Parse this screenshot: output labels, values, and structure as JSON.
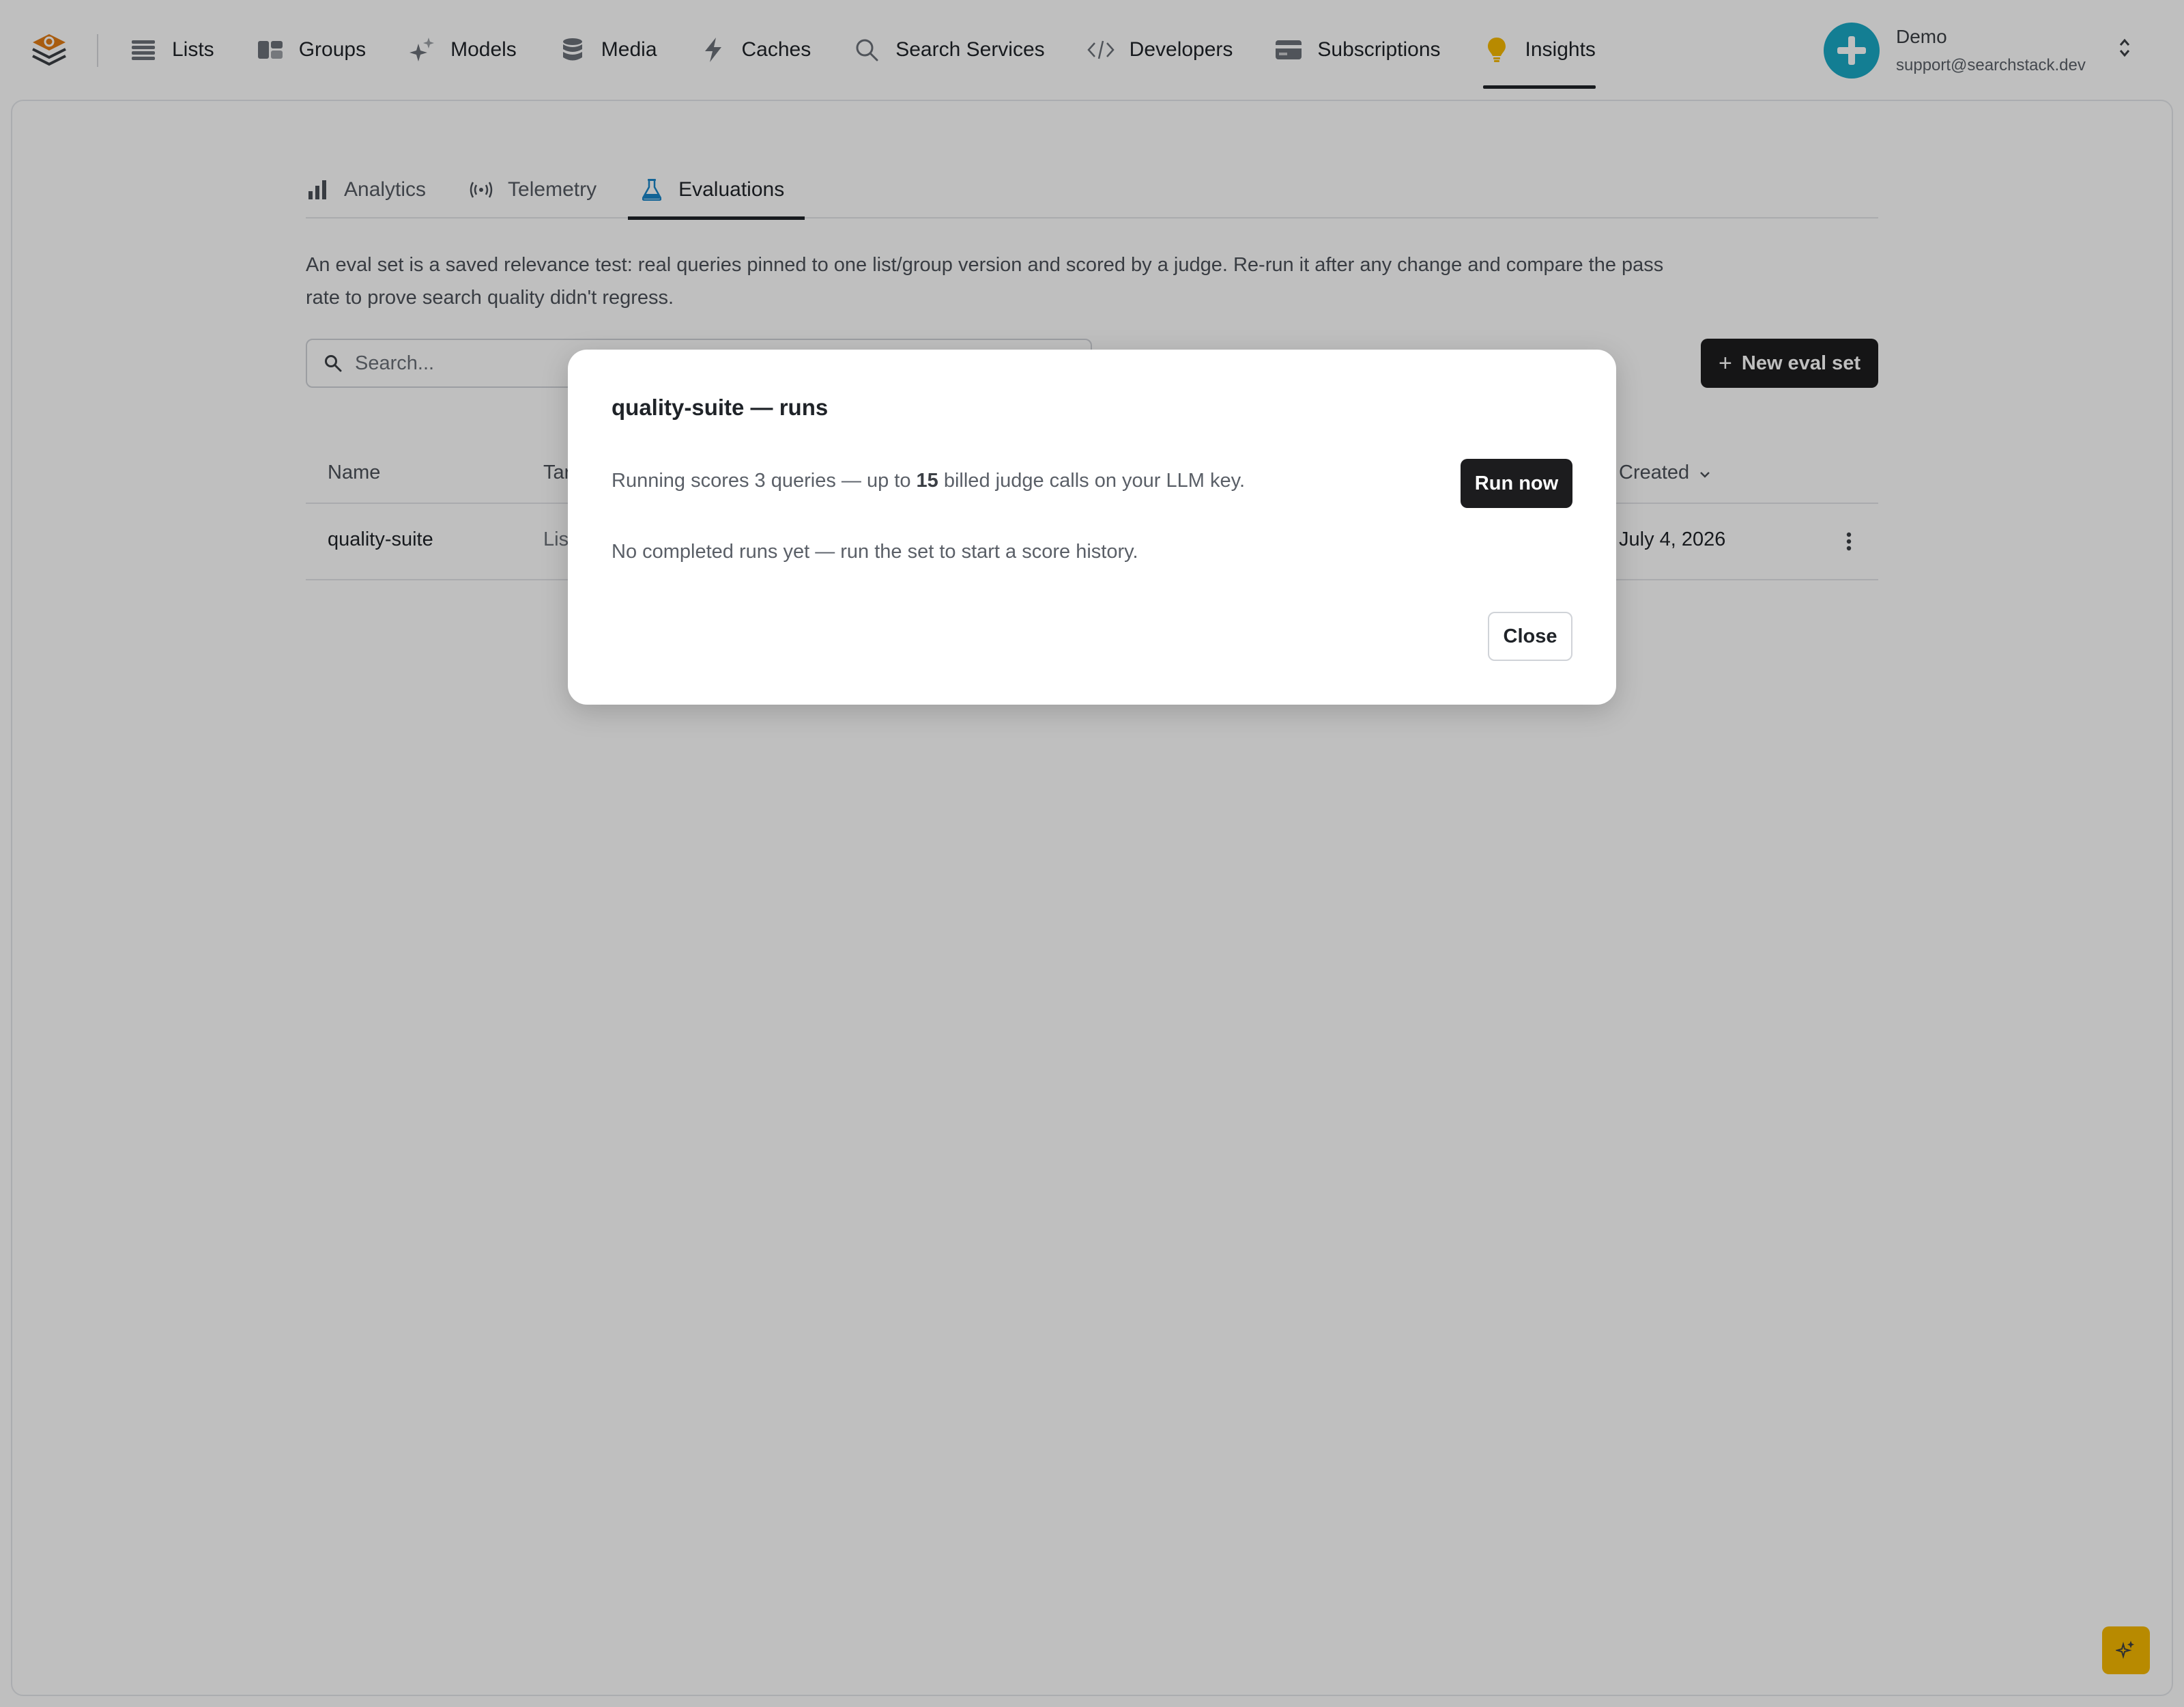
{
  "nav": {
    "items": [
      {
        "label": "Lists",
        "icon": "list-icon"
      },
      {
        "label": "Groups",
        "icon": "groups-icon"
      },
      {
        "label": "Models",
        "icon": "sparkles-icon"
      },
      {
        "label": "Media",
        "icon": "database-icon"
      },
      {
        "label": "Caches",
        "icon": "bolt-icon"
      },
      {
        "label": "Search Services",
        "icon": "search-icon"
      },
      {
        "label": "Developers",
        "icon": "code-icon"
      },
      {
        "label": "Subscriptions",
        "icon": "card-icon"
      },
      {
        "label": "Insights",
        "icon": "lightbulb-icon",
        "active": true
      }
    ]
  },
  "user": {
    "name": "Demo",
    "email": "support@searchstack.dev"
  },
  "tabs": [
    {
      "label": "Analytics",
      "icon": "bar-chart-icon"
    },
    {
      "label": "Telemetry",
      "icon": "broadcast-icon"
    },
    {
      "label": "Evaluations",
      "icon": "flask-icon",
      "active": true
    }
  ],
  "description": "An eval set is a saved relevance test: real queries pinned to one list/group version and scored by a judge. Re-run it after any change and compare the pass rate to prove search quality didn't regress.",
  "search": {
    "placeholder": "Search..."
  },
  "new_button": {
    "label": "New eval set"
  },
  "table": {
    "columns": {
      "name": "Name",
      "target": "Tar",
      "created": "Created"
    },
    "rows": [
      {
        "name": "quality-suite",
        "target": "Lis",
        "created": "July 4, 2026"
      }
    ]
  },
  "modal": {
    "title": "quality-suite — runs",
    "info_prefix": "Running scores 3 queries — up to ",
    "info_count": "15",
    "info_suffix": " billed judge calls on your LLM key.",
    "run_label": "Run now",
    "empty": "No completed runs yet — run the set to start a score history.",
    "close_label": "Close"
  },
  "colors": {
    "accent_dark": "#1c1c1e",
    "avatar": "#1aa8c4",
    "logo": "#e07b14",
    "insights_icon": "#f6b800",
    "flask_icon": "#1a86c8",
    "fab": "#f6b800"
  }
}
